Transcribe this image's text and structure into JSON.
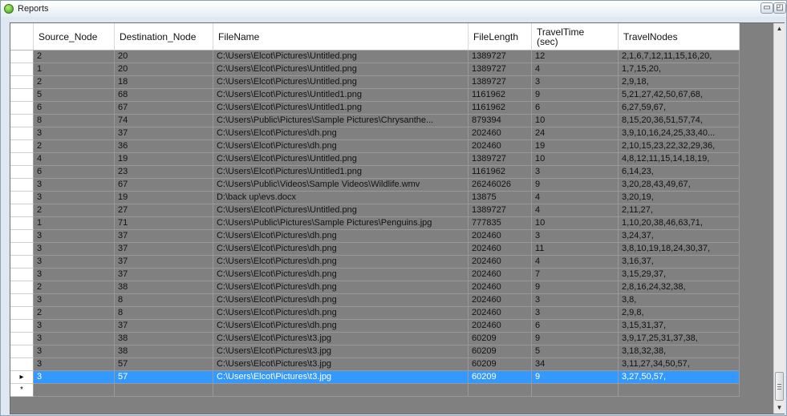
{
  "window": {
    "title": "Reports",
    "minimize_glyph": "▭",
    "maximize_glyph": "◰"
  },
  "grid": {
    "columns": [
      "Source_Node",
      "Destination_Node",
      "FileName",
      "FileLength",
      "TravelTime\n(sec)",
      "TravelNodes"
    ],
    "rows": [
      [
        "2",
        "20",
        "C:\\Users\\Elcot\\Pictures\\Untitled.png",
        "1389727",
        "12",
        "2,1,6,7,12,11,15,16,20,"
      ],
      [
        "1",
        "20",
        "C:\\Users\\Elcot\\Pictures\\Untitled.png",
        "1389727",
        "4",
        "1,7,15,20,"
      ],
      [
        "2",
        "18",
        "C:\\Users\\Elcot\\Pictures\\Untitled.png",
        "1389727",
        "3",
        "2,9,18,"
      ],
      [
        "5",
        "68",
        "C:\\Users\\Elcot\\Pictures\\Untitled1.png",
        "1161962",
        "9",
        "5,21,27,42,50,67,68,"
      ],
      [
        "6",
        "67",
        "C:\\Users\\Elcot\\Pictures\\Untitled1.png",
        "1161962",
        "6",
        "6,27,59,67,"
      ],
      [
        "8",
        "74",
        "C:\\Users\\Public\\Pictures\\Sample Pictures\\Chrysanthe...",
        "879394",
        "10",
        "8,15,20,36,51,57,74,"
      ],
      [
        "3",
        "37",
        "C:\\Users\\Elcot\\Pictures\\dh.png",
        "202460",
        "24",
        "3,9,10,16,24,25,33,40..."
      ],
      [
        "2",
        "36",
        "C:\\Users\\Elcot\\Pictures\\dh.png",
        "202460",
        "19",
        "2,10,15,23,22,32,29,36,"
      ],
      [
        "4",
        "19",
        "C:\\Users\\Elcot\\Pictures\\Untitled.png",
        "1389727",
        "10",
        "4,8,12,11,15,14,18,19,"
      ],
      [
        "6",
        "23",
        "C:\\Users\\Elcot\\Pictures\\Untitled1.png",
        "1161962",
        "3",
        "6,14,23,"
      ],
      [
        "3",
        "67",
        "C:\\Users\\Public\\Videos\\Sample Videos\\Wildlife.wmv",
        "26246026",
        "9",
        "3,20,28,43,49,67,"
      ],
      [
        "3",
        "19",
        "D:\\back up\\evs.docx",
        "13875",
        "4",
        "3,20,19,"
      ],
      [
        "2",
        "27",
        "C:\\Users\\Elcot\\Pictures\\Untitled.png",
        "1389727",
        "4",
        "2,11,27,"
      ],
      [
        "1",
        "71",
        "C:\\Users\\Public\\Pictures\\Sample Pictures\\Penguins.jpg",
        "777835",
        "10",
        "1,10,20,38,46,63,71,"
      ],
      [
        "3",
        "37",
        "C:\\Users\\Elcot\\Pictures\\dh.png",
        "202460",
        "3",
        "3,24,37,"
      ],
      [
        "3",
        "37",
        "C:\\Users\\Elcot\\Pictures\\dh.png",
        "202460",
        "11",
        "3,8,10,19,18,24,30,37,"
      ],
      [
        "3",
        "37",
        "C:\\Users\\Elcot\\Pictures\\dh.png",
        "202460",
        "4",
        "3,16,37,"
      ],
      [
        "3",
        "37",
        "C:\\Users\\Elcot\\Pictures\\dh.png",
        "202460",
        "7",
        "3,15,29,37,"
      ],
      [
        "2",
        "38",
        "C:\\Users\\Elcot\\Pictures\\dh.png",
        "202460",
        "9",
        "2,8,16,24,32,38,"
      ],
      [
        "3",
        "8",
        "C:\\Users\\Elcot\\Pictures\\dh.png",
        "202460",
        "3",
        "3,8,"
      ],
      [
        "2",
        "8",
        "C:\\Users\\Elcot\\Pictures\\dh.png",
        "202460",
        "3",
        "2,9,8,"
      ],
      [
        "3",
        "37",
        "C:\\Users\\Elcot\\Pictures\\dh.png",
        "202460",
        "6",
        "3,15,31,37,"
      ],
      [
        "3",
        "38",
        "C:\\Users\\Elcot\\Pictures\\t3.jpg",
        "60209",
        "9",
        "3,9,17,25,31,37,38,"
      ],
      [
        "3",
        "38",
        "C:\\Users\\Elcot\\Pictures\\t3.jpg",
        "60209",
        "5",
        "3,18,32,38,"
      ],
      [
        "3",
        "57",
        "C:\\Users\\Elcot\\Pictures\\t3.jpg",
        "60209",
        "34",
        "3,11,27,34,50,57,"
      ],
      [
        "3",
        "57",
        "C:\\Users\\Elcot\\Pictures\\t3.jpg",
        "60209",
        "9",
        "3,27,50,57,"
      ]
    ],
    "selected_row": 25,
    "current_row_marker": "▸",
    "new_row_marker": "*"
  },
  "scrollbar": {
    "up_glyph": "▲",
    "down_glyph": "▼",
    "position": 0.95
  },
  "colors": {
    "selection": "#3399ff",
    "cell_background": "#808080"
  }
}
